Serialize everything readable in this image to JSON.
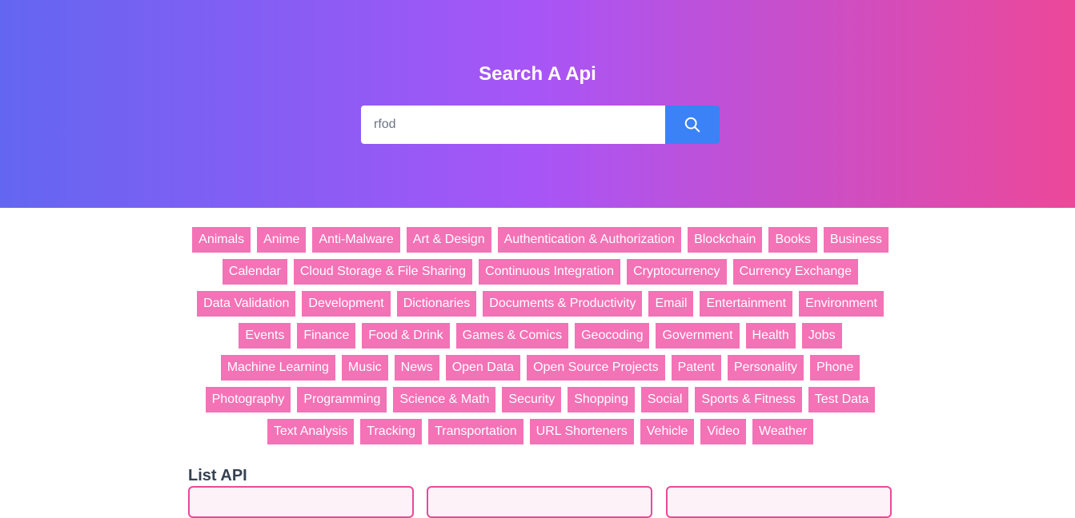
{
  "hero": {
    "title": "Search A Api"
  },
  "search": {
    "value": "rfod",
    "icon": "search-icon"
  },
  "categories": [
    [
      "Animals",
      "Anime",
      "Anti-Malware",
      "Art & Design",
      "Authentication & Authorization",
      "Blockchain",
      "Books",
      "Business"
    ],
    [
      "Calendar",
      "Cloud Storage & File Sharing",
      "Continuous Integration",
      "Cryptocurrency",
      "Currency Exchange"
    ],
    [
      "Data Validation",
      "Development",
      "Dictionaries",
      "Documents & Productivity",
      "Email",
      "Entertainment",
      "Environment"
    ],
    [
      "Events",
      "Finance",
      "Food & Drink",
      "Games & Comics",
      "Geocoding",
      "Government",
      "Health",
      "Jobs"
    ],
    [
      "Machine Learning",
      "Music",
      "News",
      "Open Data",
      "Open Source Projects",
      "Patent",
      "Personality",
      "Phone"
    ],
    [
      "Photography",
      "Programming",
      "Science & Math",
      "Security",
      "Shopping",
      "Social",
      "Sports & Fitness",
      "Test Data"
    ],
    [
      "Text Analysis",
      "Tracking",
      "Transportation",
      "URL Shorteners",
      "Vehicle",
      "Video",
      "Weather"
    ]
  ],
  "list": {
    "title": "List API"
  },
  "colors": {
    "gradient_start": "#6366f1",
    "gradient_mid": "#a855f7",
    "gradient_end": "#ec4899",
    "tag_bg": "#f472b6",
    "search_button": "#3b82f6",
    "card_border": "#ec4899"
  }
}
